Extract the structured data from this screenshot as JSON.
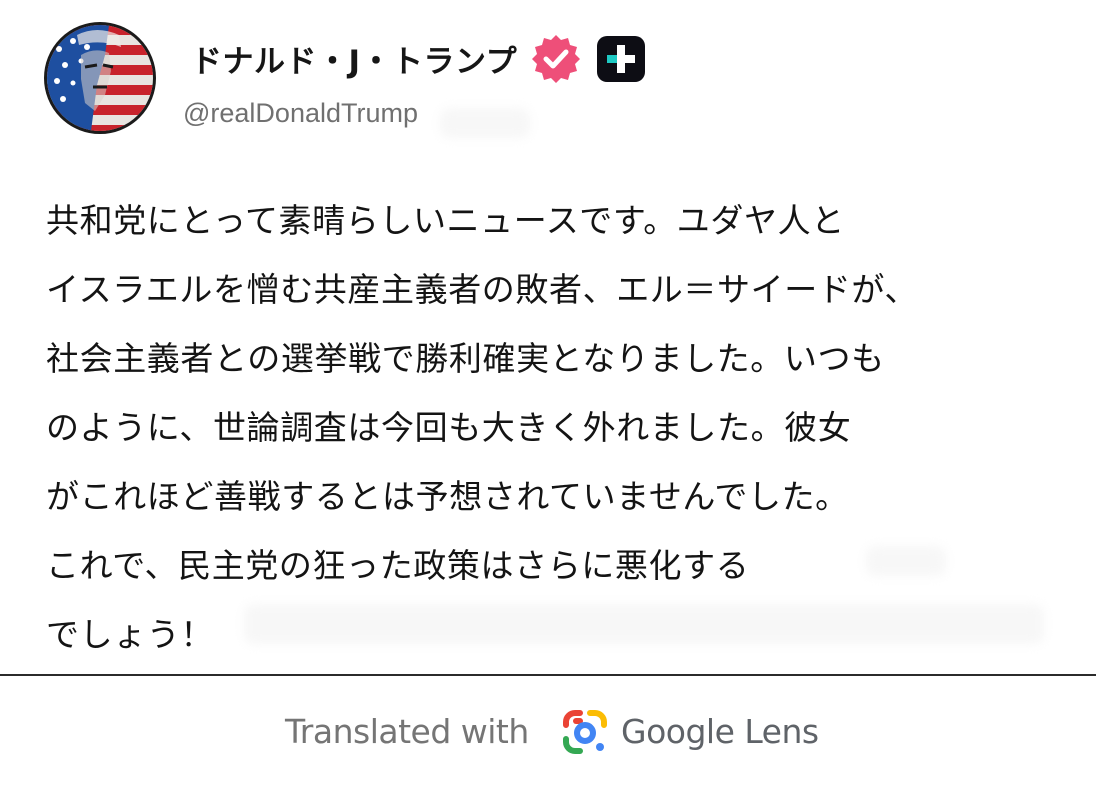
{
  "post": {
    "author": {
      "display_name": "ドナルド・J・トランプ",
      "handle": "@realDonaldTrump",
      "avatar_icon": "flag-painted-portrait",
      "verified_icon": "verified-badge-icon",
      "verified_color": "#ee4f79",
      "badge_icon": "plus-badge-icon"
    },
    "lines": [
      "共和党にとって素晴らしいニュースです。ユダヤ人と",
      "イスラエルを憎む共産主義者の敗者、エル＝サイードが、",
      "社会主義者との選挙戦で勝利確実となりました。いつも",
      "のように、世論調査は今回も大きく外れました。彼女",
      "がこれほど善戦するとは予想されていませんでした。",
      "これで、民主党の狂った政策はさらに悪化する",
      "でしょう！"
    ]
  },
  "footer": {
    "translated_with": "Translated with",
    "lens_brand": "Google Lens",
    "lens_icon": "google-lens-icon"
  }
}
